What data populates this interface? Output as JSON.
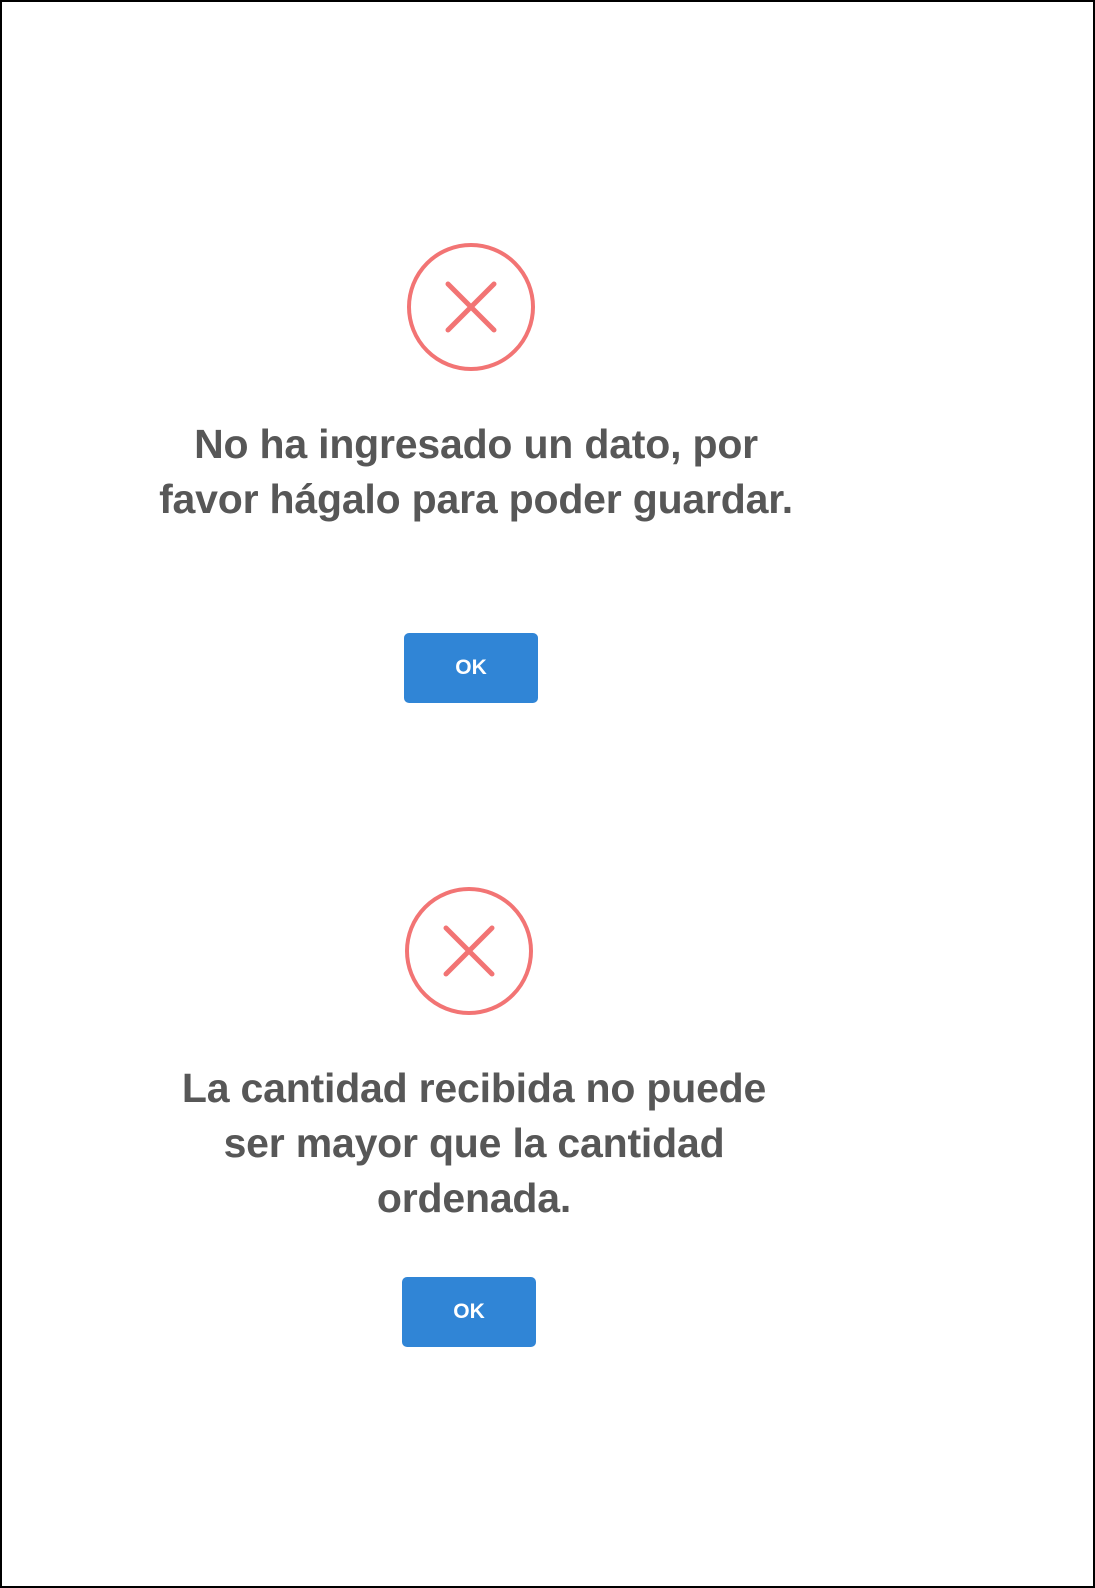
{
  "colors": {
    "error_accent": "#f27474",
    "message_text": "#575757",
    "button_background": "#3085d6",
    "button_text": "#ffffff",
    "page_background": "#ffffff"
  },
  "dialogs": [
    {
      "icon": "error-x-icon",
      "message": "No ha ingresado un dato, por favor hágalo para poder guardar.",
      "button_label": "OK"
    },
    {
      "icon": "error-x-icon",
      "message": "La cantidad recibida no puede ser mayor que la cantidad ordenada.",
      "button_label": "OK"
    }
  ]
}
